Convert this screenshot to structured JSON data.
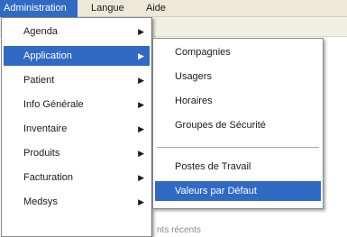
{
  "menubar": {
    "items": [
      {
        "label": "Administration",
        "active": true
      },
      {
        "label": "Langue",
        "active": false
      },
      {
        "label": "Aide",
        "active": false
      }
    ]
  },
  "admin_menu": {
    "items": [
      {
        "label": "Agenda",
        "has_submenu": true,
        "highlighted": false
      },
      {
        "label": "Application",
        "has_submenu": true,
        "highlighted": true
      },
      {
        "label": "Patient",
        "has_submenu": true,
        "highlighted": false
      },
      {
        "label": "Info Générale",
        "has_submenu": true,
        "highlighted": false
      },
      {
        "label": "Inventaire",
        "has_submenu": true,
        "highlighted": false
      },
      {
        "label": "Produits",
        "has_submenu": true,
        "highlighted": false
      },
      {
        "label": "Facturation",
        "has_submenu": true,
        "highlighted": false
      },
      {
        "label": "Medsys",
        "has_submenu": true,
        "highlighted": false
      }
    ],
    "arrow_icon": "chevron-right-icon"
  },
  "application_submenu": {
    "items": [
      {
        "label": "Compagnies",
        "highlighted": false
      },
      {
        "label": "Usagers",
        "highlighted": false
      },
      {
        "label": "Horaires",
        "highlighted": false
      },
      {
        "label": "Groupes de Sécurité",
        "highlighted": false
      },
      {
        "label": "Postes de Travail",
        "highlighted": false
      },
      {
        "label": "Valeurs par Défaut",
        "highlighted": true
      }
    ]
  },
  "background": {
    "partial_text": "nts récents"
  },
  "colors": {
    "highlight": "#316ac5",
    "menubar": "#ece9d8",
    "menu_bg": "#ffffff"
  }
}
